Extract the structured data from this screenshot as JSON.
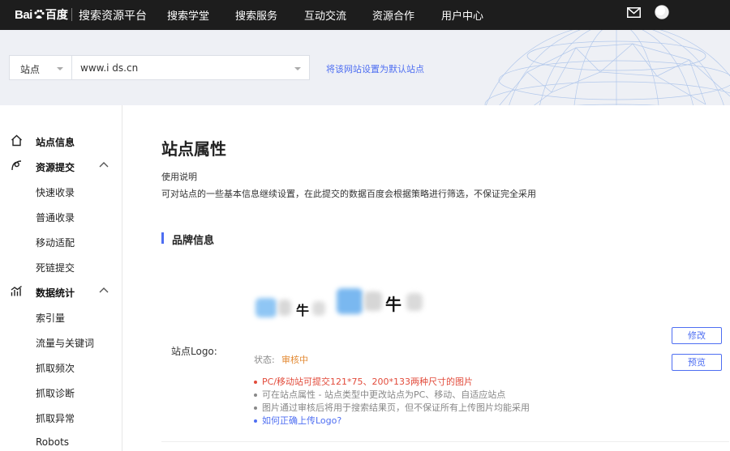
{
  "topnav": {
    "logo_text_a": "Bai",
    "logo_text_b": "百度",
    "platform": "搜索资源平台",
    "items": [
      "搜索学堂",
      "搜索服务",
      "互动交流",
      "资源合作",
      "用户中心"
    ],
    "icons": [
      "mail-icon",
      "globe-icon"
    ]
  },
  "banner": {
    "site_select": "站点",
    "url_value": "www.i          ds.cn",
    "set_default": "将该网站设置为默认站点"
  },
  "sidebar": {
    "items": [
      {
        "label": "站点信息",
        "icon": "home-icon"
      },
      {
        "label": "资源提交",
        "icon": "submit-icon"
      },
      {
        "label": "快速收录"
      },
      {
        "label": "普通收录"
      },
      {
        "label": "移动适配"
      },
      {
        "label": "死链提交"
      },
      {
        "label": "数据统计",
        "icon": "chart-icon"
      },
      {
        "label": "索引量"
      },
      {
        "label": "流量与关键词"
      },
      {
        "label": "抓取频次"
      },
      {
        "label": "抓取诊断"
      },
      {
        "label": "抓取异常"
      },
      {
        "label": "Robots"
      }
    ]
  },
  "main": {
    "title": "站点属性",
    "usage_title": "使用说明",
    "usage_desc": "可对站点的一些基本信息继续设置，在此提交的数据百度会根据策略进行筛选，不保证完全采用",
    "section_title": "品牌信息",
    "logo_label": "站点Logo:",
    "thumb_char": "牛",
    "status_label": "状态:",
    "status_value": "审核中",
    "edit_button": "修改",
    "preview_button": "预览",
    "rules": [
      "PC/移动站可提交121*75、200*133两种尺寸的图片",
      "可在站点属性 - 站点类型中更改站点为PC、移动、自适应站点",
      "图片通过审核后将用于搜索结果页，但不保证所有上传图片均能采用",
      "如何正确上传Logo?"
    ]
  },
  "colors": {
    "accent": "#4e6ef2",
    "warning": "#e38b35",
    "error": "#e24b3b",
    "nav_bg": "#1d1d1d"
  }
}
